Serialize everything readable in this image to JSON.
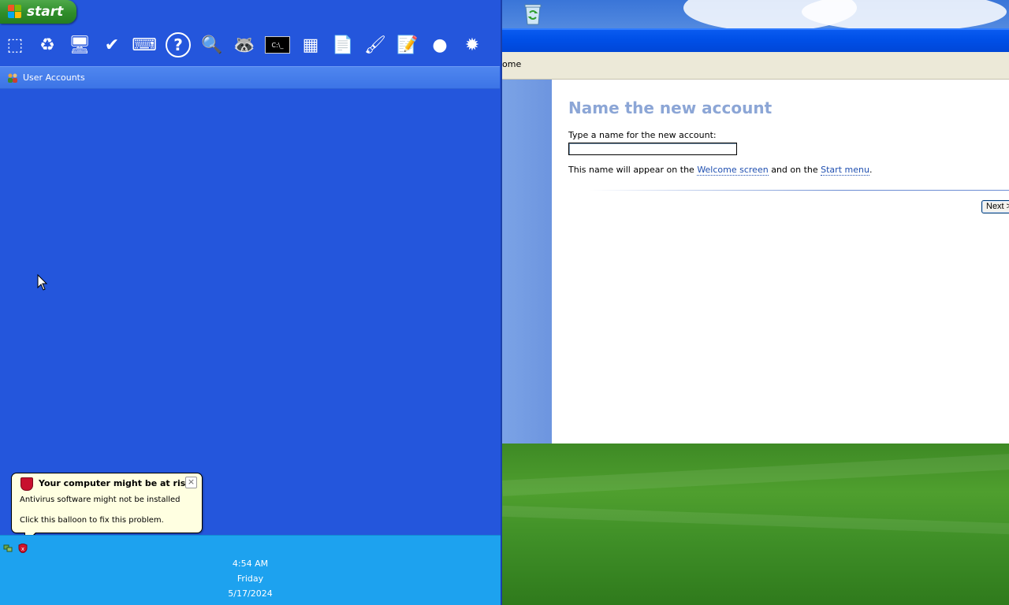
{
  "taskbar": {
    "start_label": "start",
    "quick_launch": [
      {
        "name": "show-desktop-icon",
        "glyph": "⬚"
      },
      {
        "name": "recycle-bin-icon",
        "glyph": "♻"
      },
      {
        "name": "my-computer-icon",
        "glyph": "🖥"
      },
      {
        "name": "checklist-icon",
        "glyph": "✔"
      },
      {
        "name": "keyboard-icon",
        "glyph": "⌨"
      },
      {
        "name": "help-icon",
        "glyph": "?"
      },
      {
        "name": "search-icon",
        "glyph": "🔍"
      },
      {
        "name": "raccoon-icon",
        "glyph": "🦝"
      },
      {
        "name": "command-prompt-icon",
        "glyph": "C:\\_"
      },
      {
        "name": "calculator-icon",
        "glyph": "▦"
      },
      {
        "name": "notepad-icon",
        "glyph": "📄"
      },
      {
        "name": "paint-icon",
        "glyph": "🖌"
      },
      {
        "name": "wordpad-icon",
        "glyph": "📝"
      },
      {
        "name": "sphere-icon",
        "glyph": "●"
      },
      {
        "name": "minesweeper-icon",
        "glyph": "✹"
      }
    ],
    "task_label": "User Accounts"
  },
  "balloon": {
    "title": "Your computer might be at risk",
    "line1": "Antivirus software might not be installed",
    "line2": "Click this balloon to fix this problem.",
    "close": "×"
  },
  "tray": {
    "time": "4:54 AM",
    "day": "Friday",
    "date": "5/17/2024"
  },
  "window": {
    "address_fragment": "ome",
    "heading": "Name the new account",
    "prompt": "Type a name for the new account:",
    "input_value": "",
    "note_prefix": "This name will appear on the ",
    "note_link1": "Welcome screen",
    "note_middle": " and on the ",
    "note_link2": "Start menu",
    "note_suffix": ".",
    "next_label": "Next >"
  }
}
